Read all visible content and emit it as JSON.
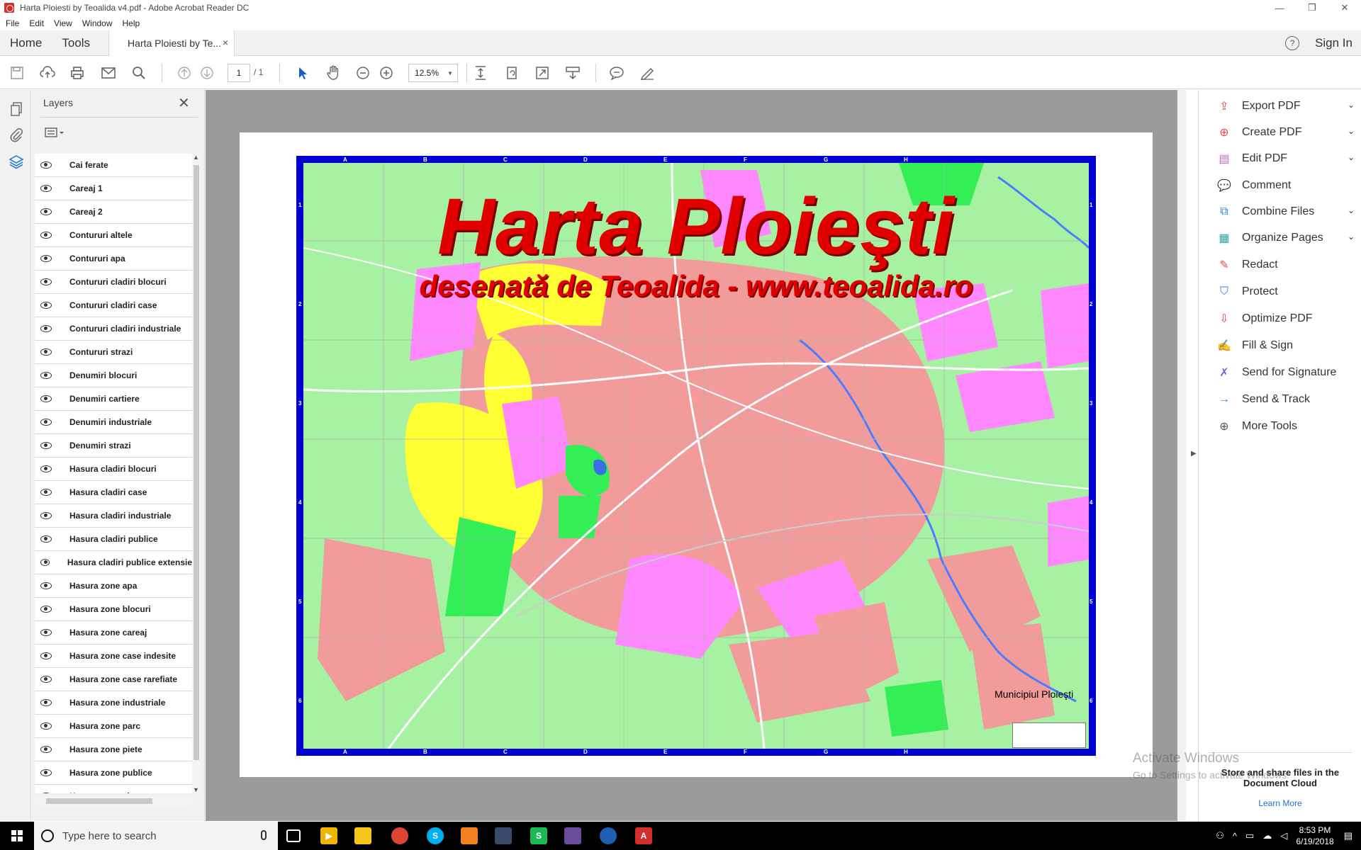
{
  "window": {
    "title": "Harta Ploiesti by Teoalida v4.pdf - Adobe Acrobat Reader DC",
    "controls": [
      "—",
      "❐",
      "✕"
    ]
  },
  "menu": [
    "File",
    "Edit",
    "View",
    "Window",
    "Help"
  ],
  "nav": {
    "home": "Home",
    "tools": "Tools",
    "tab_title": "Harta Ploiesti by Te...",
    "tab_close": "×",
    "help": "?",
    "sign_in": "Sign In"
  },
  "toolbar": {
    "page_current": "1",
    "page_total": "/ 1",
    "zoom": "12.5%"
  },
  "layers": {
    "title": "Layers",
    "items": [
      "Cai ferate",
      "Careaj 1",
      "Careaj 2",
      "Contururi altele",
      "Contururi apa",
      "Contururi cladiri blocuri",
      "Contururi cladiri case",
      "Contururi cladiri industriale",
      "Contururi strazi",
      "Denumiri blocuri",
      "Denumiri cartiere",
      "Denumiri industriale",
      "Denumiri strazi",
      "Hasura cladiri blocuri",
      "Hasura cladiri case",
      "Hasura cladiri industriale",
      "Hasura cladiri publice",
      "Hasura cladiri publice extensie",
      "Hasura zone apa",
      "Hasura zone blocuri",
      "Hasura zone careaj",
      "Hasura zone case indesite",
      "Hasura zone case rarefiate",
      "Hasura zone industriale",
      "Hasura zone parc",
      "Hasura zone piete",
      "Hasura zone publice",
      "Hasura zone virane"
    ]
  },
  "map": {
    "title": "Harta Ploieşti",
    "subtitle": "desenată de Teoalida - www.teoalida.ro",
    "municipality": "Municipiul Ploieşti",
    "grid_letters": [
      "A",
      "B",
      "C",
      "D",
      "E",
      "F",
      "G",
      "H"
    ],
    "grid_numbers": [
      "1",
      "2",
      "3",
      "4",
      "5",
      "6"
    ],
    "colors": {
      "border": "#0000d0",
      "ground": "#a7f1a2",
      "houses": "#f29b9b",
      "blocks": "#ffff33",
      "industrial": "#ff88ff",
      "title": "#e00000"
    }
  },
  "tools": [
    {
      "label": "Export PDF",
      "icon": "export-pdf-icon",
      "color": "#e34850",
      "chevron": true
    },
    {
      "label": "Create PDF",
      "icon": "create-pdf-icon",
      "color": "#e34850",
      "chevron": true
    },
    {
      "label": "Edit PDF",
      "icon": "edit-pdf-icon",
      "color": "#d85dd8",
      "chevron": true
    },
    {
      "label": "Comment",
      "icon": "comment-icon",
      "color": "#f5c518",
      "chevron": false
    },
    {
      "label": "Combine Files",
      "icon": "combine-files-icon",
      "color": "#2680eb",
      "chevron": true
    },
    {
      "label": "Organize Pages",
      "icon": "organize-pages-icon",
      "color": "#2ba3a3",
      "chevron": true
    },
    {
      "label": "Redact",
      "icon": "redact-icon",
      "color": "#e34850",
      "chevron": false
    },
    {
      "label": "Protect",
      "icon": "protect-icon",
      "color": "#2680eb",
      "chevron": false
    },
    {
      "label": "Optimize PDF",
      "icon": "optimize-pdf-icon",
      "color": "#e34850",
      "chevron": false
    },
    {
      "label": "Fill & Sign",
      "icon": "fill-sign-icon",
      "color": "#7a5cd8",
      "chevron": false
    },
    {
      "label": "Send for Signature",
      "icon": "send-signature-icon",
      "color": "#7a5cd8",
      "chevron": false
    },
    {
      "label": "Send & Track",
      "icon": "send-track-icon",
      "color": "#2680eb",
      "chevron": false
    },
    {
      "label": "More Tools",
      "icon": "more-tools-icon",
      "color": "#555555",
      "chevron": false
    }
  ],
  "cloud": {
    "text": "Store and share files in the Document Cloud",
    "learn_more": "Learn More"
  },
  "watermark": {
    "line1": "Activate Windows",
    "line2": "Go to Settings to activate Windows."
  },
  "taskbar": {
    "search_placeholder": "Type here to search",
    "time": "8:53 PM",
    "date": "6/19/2018"
  }
}
